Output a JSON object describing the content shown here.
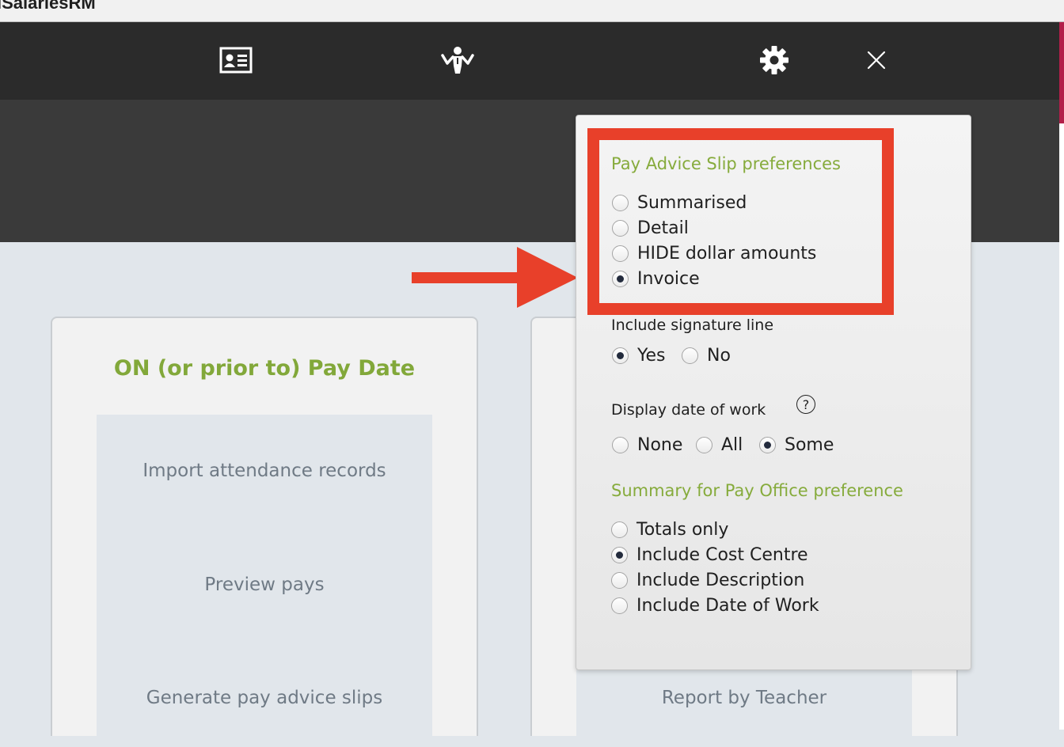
{
  "app": {
    "title": "iSalariesRM"
  },
  "toolbar": {
    "icons": [
      "id-card-icon",
      "person-shrug-icon",
      "gear-icon",
      "close-icon"
    ]
  },
  "cards": {
    "left": {
      "title": "ON (or prior to) Pay Date",
      "links": [
        "Import attendance records",
        "Preview pays",
        "Generate pay advice slips"
      ]
    },
    "right": {
      "links": [
        "Report by Teacher"
      ]
    }
  },
  "popover": {
    "pay_advice": {
      "title": "Pay Advice Slip preferences",
      "options": [
        "Summarised",
        "Detail",
        "HIDE dollar amounts",
        "Invoice"
      ],
      "selected": "Invoice"
    },
    "signature": {
      "label": "Include signature line",
      "options": [
        "Yes",
        "No"
      ],
      "selected": "Yes"
    },
    "date_of_work": {
      "label": "Display date of work",
      "help": "?",
      "options": [
        "None",
        "All",
        "Some"
      ],
      "selected": "Some"
    },
    "pay_office": {
      "title": "Summary for Pay Office preference",
      "options": [
        "Totals only",
        "Include Cost Centre",
        "Include Description",
        "Include Date of Work"
      ],
      "selected": "Include Cost Centre"
    }
  },
  "colors": {
    "accent_green": "#82a83a",
    "highlight_red": "#e8402a",
    "toolbar_bg": "#2b2b2b"
  }
}
